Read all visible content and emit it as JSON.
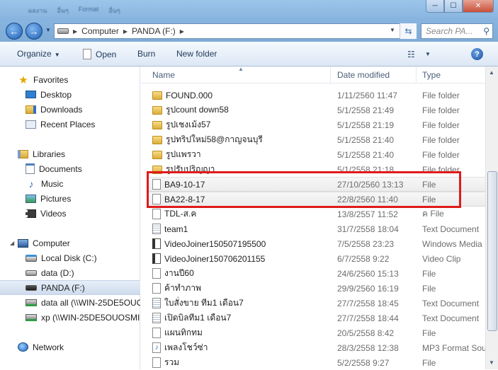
{
  "window": {
    "title_tabs": [
      "ผลงาน",
      "อื่นๆ",
      "Format",
      "อื่นๆ"
    ],
    "buttons": {
      "minimize": "─",
      "maximize": "☐",
      "close": "✕"
    }
  },
  "address": {
    "crumbs": [
      "Computer",
      "PANDA (F:)"
    ],
    "search_placeholder": "Search PA..."
  },
  "toolbar": {
    "organize": "Organize",
    "open": "Open",
    "burn": "Burn",
    "new_folder": "New folder",
    "help": "?"
  },
  "nav": {
    "favorites": "Favorites",
    "desktop": "Desktop",
    "downloads": "Downloads",
    "recent": "Recent Places",
    "libraries": "Libraries",
    "documents": "Documents",
    "music": "Music",
    "pictures": "Pictures",
    "videos": "Videos",
    "computer": "Computer",
    "local_disk": "Local Disk (C:)",
    "data_d": "data (D:)",
    "panda": "PANDA (F:)",
    "data_all": "data all (\\\\WIN-25DE5OUO",
    "xp": "xp (\\\\WIN-25DE5OUOSMI",
    "network": "Network"
  },
  "columns": {
    "name": "Name",
    "date": "Date modified",
    "type": "Type"
  },
  "files": [
    {
      "name": "FOUND.000",
      "date": "1/11/2560 11:47",
      "type": "File folder",
      "icon": "folder"
    },
    {
      "name": "รูปcount down58",
      "date": "5/1/2558 21:49",
      "type": "File folder",
      "icon": "folder"
    },
    {
      "name": "รูปเชงเม้ง57",
      "date": "5/1/2558 21:19",
      "type": "File folder",
      "icon": "folder"
    },
    {
      "name": "รูปทริปใหม่58@กาญจนบุรี",
      "date": "5/1/2558 21:40",
      "type": "File folder",
      "icon": "folder"
    },
    {
      "name": "รูปแพรวา",
      "date": "5/1/2558 21:40",
      "type": "File folder",
      "icon": "folder"
    },
    {
      "name": "รูปรับปริญญา",
      "date": "5/1/2558 21:18",
      "type": "File folder",
      "icon": "folder"
    },
    {
      "name": "BA9-10-17",
      "date": "27/10/2560 13:13",
      "type": "File",
      "icon": "file"
    },
    {
      "name": "BA22-8-17",
      "date": "22/8/2560 11:40",
      "type": "File",
      "icon": "file"
    },
    {
      "name": "TDL-ส.ค",
      "date": "13/8/2557 11:52",
      "type": "ค File",
      "icon": "file"
    },
    {
      "name": "team1",
      "date": "31/7/2558 18:04",
      "type": "Text Document",
      "icon": "text"
    },
    {
      "name": "VideoJoiner150507195500",
      "date": "7/5/2558 23:23",
      "type": "Windows Media",
      "icon": "video"
    },
    {
      "name": "VideoJoiner150706201155",
      "date": "6/7/2558 9:22",
      "type": "Video Clip",
      "icon": "video"
    },
    {
      "name": "งานปี60",
      "date": "24/6/2560 15:13",
      "type": "File",
      "icon": "file"
    },
    {
      "name": "ค้าทำภาพ",
      "date": "29/9/2560 16:19",
      "type": "File",
      "icon": "file"
    },
    {
      "name": "ใบสั่งขาย ทีม1 เดือน7",
      "date": "27/7/2558 18:45",
      "type": "Text Document",
      "icon": "text"
    },
    {
      "name": "เปิดบิลทีม1 เดือน7",
      "date": "27/7/2558 18:44",
      "type": "Text Document",
      "icon": "text"
    },
    {
      "name": "แผนทิกทม",
      "date": "20/5/2558 8:42",
      "type": "File",
      "icon": "file"
    },
    {
      "name": "เพลงโชว์ซ่า",
      "date": "28/3/2558 12:38",
      "type": "MP3 Format Sou",
      "icon": "mp3"
    },
    {
      "name": "รวม",
      "date": "5/2/2558 9:27",
      "type": "File",
      "icon": "file"
    }
  ]
}
